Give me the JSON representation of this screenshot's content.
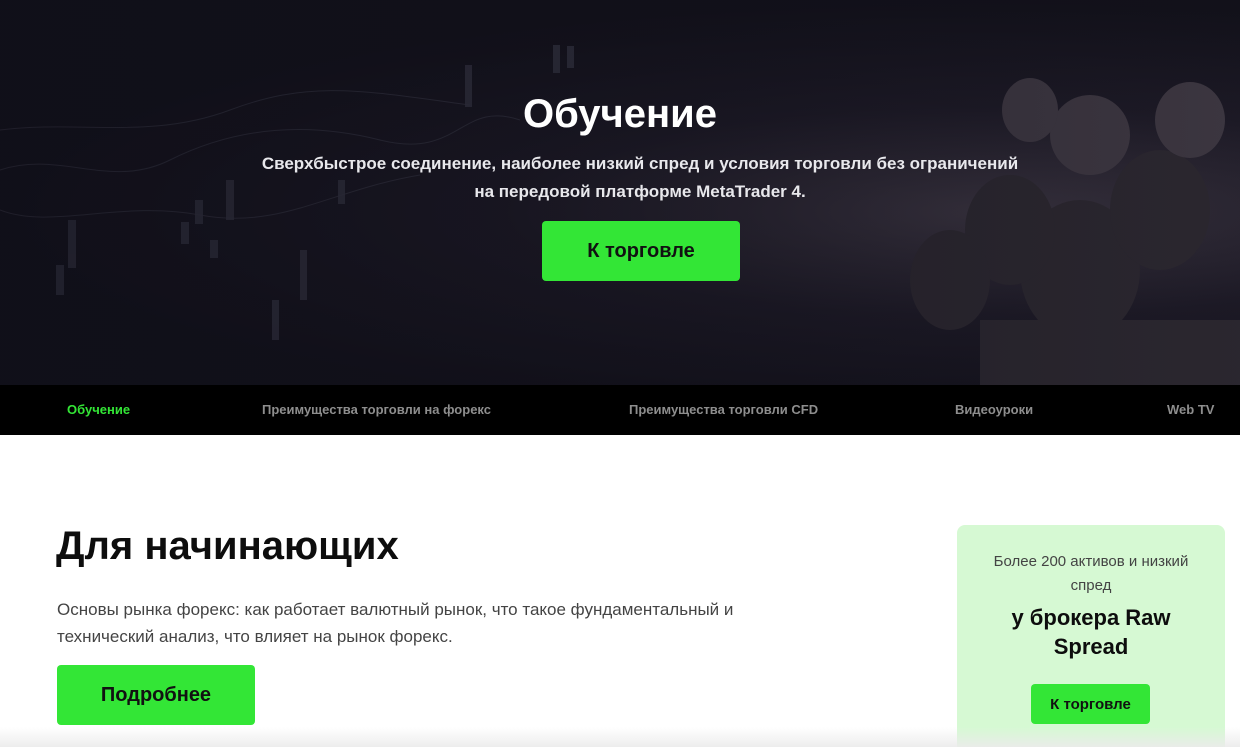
{
  "hero": {
    "title": "Обучение",
    "subtitle_line1": "Сверхбыстрое соединение, наиболее низкий спред и условия торговли без ограничений",
    "subtitle_line2": "на передовой платформе MetaTrader 4.",
    "cta_label": "К торговле"
  },
  "nav": {
    "items": [
      {
        "label": "Обучение",
        "active": true
      },
      {
        "label": "Преимущества торговли на форекс",
        "active": false
      },
      {
        "label": "Преимущества торговли CFD",
        "active": false
      },
      {
        "label": "Видеоуроки",
        "active": false
      },
      {
        "label": "Web TV",
        "active": false
      }
    ]
  },
  "section": {
    "title": "Для начинающих",
    "description_line1": "Основы рынка форекс: как работает валютный рынок, что такое фундаментальный и",
    "description_line2": "технический анализ, что влияет на рынок форекс.",
    "more_label": "Подробнее"
  },
  "promo": {
    "line1": "Более 200 активов и низкий спред",
    "line2": "у брокера Raw Spread",
    "cta_label": "К торговле"
  },
  "colors": {
    "accent": "#33e636",
    "hero_bg": "#17151f",
    "nav_bg": "#000000",
    "nav_inactive": "#8e8e8e",
    "promo_bg": "#d6f9d3"
  }
}
